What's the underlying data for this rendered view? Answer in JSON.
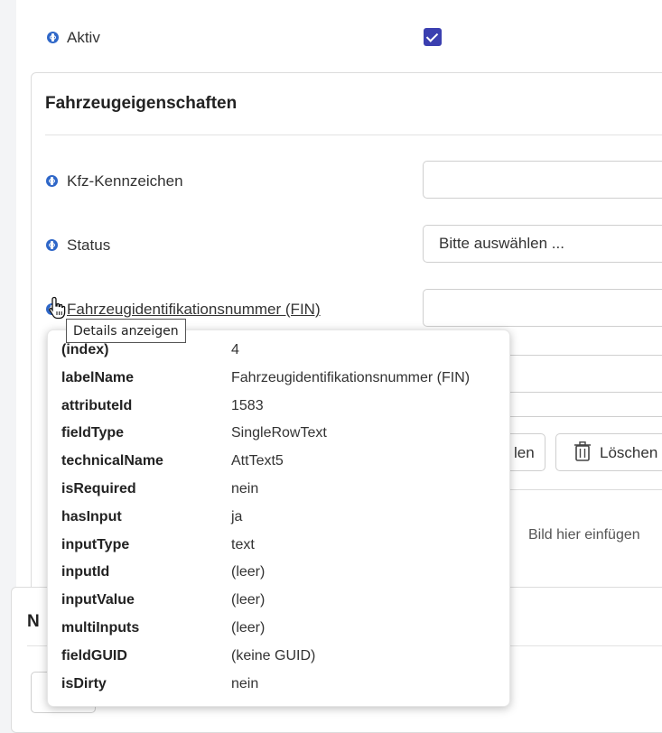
{
  "active": {
    "label": "Aktiv",
    "checked": true
  },
  "vehicle_section": {
    "title": "Fahrzeugeigenschaften",
    "fields": {
      "plate": {
        "label": "Kfz-Kennzeichen",
        "value": ""
      },
      "status": {
        "label": "Status",
        "value": "Bitte auswählen ..."
      },
      "fin": {
        "label": "Fahrzeugidentifikationsnummer (FIN)",
        "value": ""
      }
    },
    "buttons": {
      "partial_label": "len",
      "delete_label": "Löschen"
    },
    "dropzone": {
      "text": "Bild hier einfügen"
    }
  },
  "bottom_section": {
    "title_partial": "N"
  },
  "tooltip": {
    "text": "Details anzeigen"
  },
  "details": {
    "rows": [
      {
        "key": "(index)",
        "value": "4"
      },
      {
        "key": "labelName",
        "value": "Fahrzeugidentifikationsnummer (FIN)"
      },
      {
        "key": "attributeId",
        "value": "1583"
      },
      {
        "key": "fieldType",
        "value": "SingleRowText"
      },
      {
        "key": "technicalName",
        "value": "AttText5"
      },
      {
        "key": "isRequired",
        "value": "nein"
      },
      {
        "key": "hasInput",
        "value": "ja"
      },
      {
        "key": "inputType",
        "value": "text"
      },
      {
        "key": "inputId",
        "value": "(leer)"
      },
      {
        "key": "inputValue",
        "value": "(leer)"
      },
      {
        "key": "multiInputs",
        "value": "(leer)"
      },
      {
        "key": "fieldGUID",
        "value": "(keine GUID)"
      },
      {
        "key": "isDirty",
        "value": "nein"
      }
    ]
  },
  "colors": {
    "accent": "#3b3fb0",
    "info_icon": "#2f67c8"
  }
}
